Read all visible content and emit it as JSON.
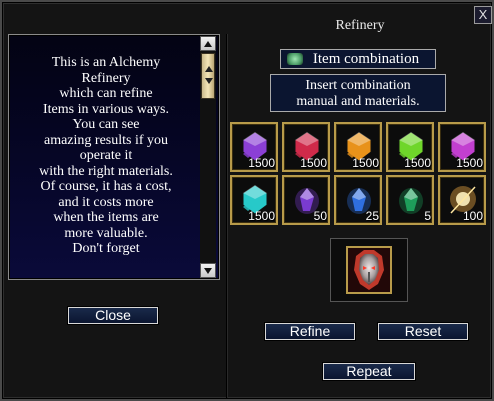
{
  "window": {
    "title": "Refinery",
    "close_symbol": "X"
  },
  "description": {
    "text": "This is an Alchemy\nRefinery\nwhich can refine\nItems in various ways.\nYou can see\namazing results if you\noperate it\nwith the right materials.\nOf course, it has a cost,\nand it costs more\nwhen the items are\nmore valuable.\nDon't forget"
  },
  "buttons": {
    "close": "Close",
    "refine": "Refine",
    "reset": "Reset",
    "repeat": "Repeat"
  },
  "combination": {
    "label": "Item combination",
    "instruction": "Insert combination\nmanual and materials."
  },
  "materials": [
    {
      "icon": "purple-gem-icon",
      "color": "#8b3fd6",
      "qty": "1500"
    },
    {
      "icon": "red-gem-icon",
      "color": "#d02a4a",
      "qty": "1500"
    },
    {
      "icon": "orange-gem-icon",
      "color": "#e8921a",
      "qty": "1500"
    },
    {
      "icon": "green-gem-icon",
      "color": "#6fd62a",
      "qty": "1500"
    },
    {
      "icon": "violet-gem-icon",
      "color": "#c23fd0",
      "qty": "1500"
    },
    {
      "icon": "cyan-gem-icon",
      "color": "#27c9c9",
      "qty": "1500"
    },
    {
      "icon": "purple-crystal-icon",
      "color": "#7a3bd0",
      "qty": "50"
    },
    {
      "icon": "blue-crystal-icon",
      "color": "#2f6fe0",
      "qty": "25"
    },
    {
      "icon": "green-crystal-icon",
      "color": "#1e9e5a",
      "qty": "5"
    },
    {
      "icon": "golden-powder-icon",
      "color": "#e0a040",
      "qty": "100"
    }
  ],
  "target_item": {
    "icon": "armor-helmet-icon"
  }
}
